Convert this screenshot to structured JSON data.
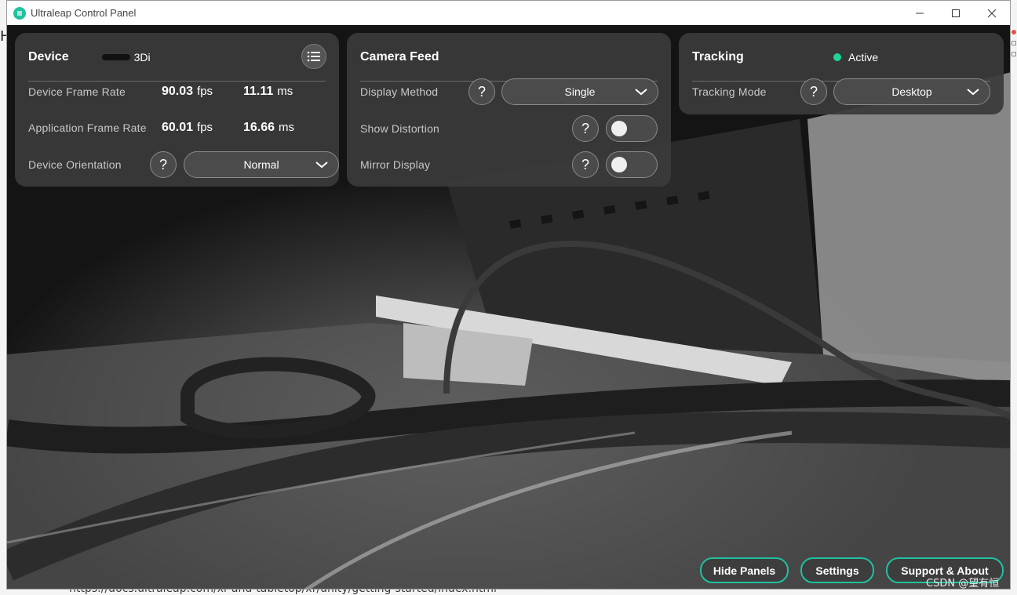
{
  "window": {
    "title": "Ultraleap Control Panel"
  },
  "background": {
    "url_text": "https://docs.ultraleap.com/xr-and-tabletop/xr/unity/getting-started/index.html",
    "left_glyph": "H"
  },
  "device_panel": {
    "title": "Device",
    "device_name": "3Di",
    "frame_rate_label": "Device Frame Rate",
    "frame_rate_fps": "90.03",
    "frame_rate_fps_unit": "fps",
    "frame_rate_ms": "11.11",
    "frame_rate_ms_unit": "ms",
    "app_rate_label": "Application Frame Rate",
    "app_rate_fps": "60.01",
    "app_rate_fps_unit": "fps",
    "app_rate_ms": "16.66",
    "app_rate_ms_unit": "ms",
    "orientation_label": "Device Orientation",
    "orientation_value": "Normal"
  },
  "camera_panel": {
    "title": "Camera Feed",
    "display_method_label": "Display Method",
    "display_method_value": "Single",
    "distortion_label": "Show Distortion",
    "distortion_on": false,
    "mirror_label": "Mirror Display",
    "mirror_on": false
  },
  "tracking_panel": {
    "title": "Tracking",
    "status": "Active",
    "mode_label": "Tracking Mode",
    "mode_value": "Desktop"
  },
  "help_glyph": "?",
  "bottom": {
    "hide_panels": "Hide Panels",
    "settings": "Settings",
    "support": "Support & About"
  },
  "watermark": "CSDN @望有恒",
  "colors": {
    "accent": "#21c0a0",
    "status_active": "#1ed49a",
    "panel_bg": "#3a3a3a"
  }
}
